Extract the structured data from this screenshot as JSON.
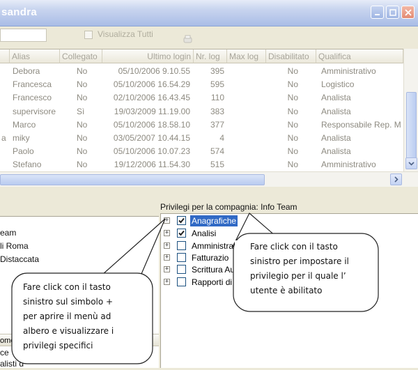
{
  "window": {
    "title_fragment": "sandra"
  },
  "toolbar": {
    "show_all_label": "Visualizza Tutti"
  },
  "grid": {
    "columns": [
      "Alias",
      "Collegato",
      "Ultimo login",
      "Nr. log",
      "Max log",
      "Disabilitato",
      "Qualifica"
    ],
    "rows": [
      {
        "prefix": "",
        "alias": "Debora",
        "collegato": "No",
        "login": "05/10/2006 9.10.55",
        "nrlog": "395",
        "maxlog": "",
        "disabilitato": "No",
        "qualifica": "Amministrativo"
      },
      {
        "prefix": "",
        "alias": "Francesca",
        "collegato": "No",
        "login": "05/10/2006 16.54.29",
        "nrlog": "595",
        "maxlog": "",
        "disabilitato": "No",
        "qualifica": "Logistico"
      },
      {
        "prefix": "",
        "alias": "Francesco",
        "collegato": "No",
        "login": "02/10/2006 16.43.45",
        "nrlog": "110",
        "maxlog": "",
        "disabilitato": "No",
        "qualifica": "Analista"
      },
      {
        "prefix": "",
        "alias": "supervisore",
        "collegato": "Sì",
        "login": "19/03/2009 11.19.00",
        "nrlog": "383",
        "maxlog": "",
        "disabilitato": "No",
        "qualifica": "Analista"
      },
      {
        "prefix": "",
        "alias": "Marco",
        "collegato": "No",
        "login": "05/10/2006 18.58.10",
        "nrlog": "377",
        "maxlog": "",
        "disabilitato": "No",
        "qualifica": "Responsabile Rep. M"
      },
      {
        "prefix": "a",
        "alias": "miky",
        "collegato": "No",
        "login": "03/05/2007 10.44.15",
        "nrlog": "4",
        "maxlog": "",
        "disabilitato": "No",
        "qualifica": "Analista"
      },
      {
        "prefix": "",
        "alias": "Paolo",
        "collegato": "No",
        "login": "05/10/2006 10.07.23",
        "nrlog": "574",
        "maxlog": "",
        "disabilitato": "No",
        "qualifica": "Analista"
      },
      {
        "prefix": "",
        "alias": "Stefano",
        "collegato": "No",
        "login": "19/12/2006 11.54.30",
        "nrlog": "515",
        "maxlog": "",
        "disabilitato": "No",
        "qualifica": "Amministrativo"
      }
    ]
  },
  "left_panel": {
    "items": [
      "eam",
      "li Roma",
      "Distaccata"
    ],
    "header_fragment": "ome",
    "bottom_fragments": [
      "ce",
      "alisti d"
    ]
  },
  "privileges": {
    "label": "Privilegi per la compagnia: Info Team",
    "tree": [
      {
        "label": "Anagrafiche",
        "checked": true,
        "selected": true
      },
      {
        "label": "Analisi",
        "checked": true,
        "selected": false
      },
      {
        "label": "Amministra",
        "checked": false,
        "selected": false
      },
      {
        "label": "Fatturazio",
        "checked": false,
        "selected": false
      },
      {
        "label": "Scrittura Au",
        "checked": false,
        "selected": false
      },
      {
        "label": "Rapporti di l",
        "checked": false,
        "selected": false
      }
    ]
  },
  "callouts": {
    "left": [
      "Fare click con il tasto",
      "sinistro sul simbolo +",
      "per aprire il menù ad",
      "albero e visualizzare i",
      "privilegi specifici"
    ],
    "right": [
      "Fare click con il tasto",
      "sinistro per impostare il",
      "privilegio per il quale l’",
      "utente è abilitato"
    ]
  }
}
